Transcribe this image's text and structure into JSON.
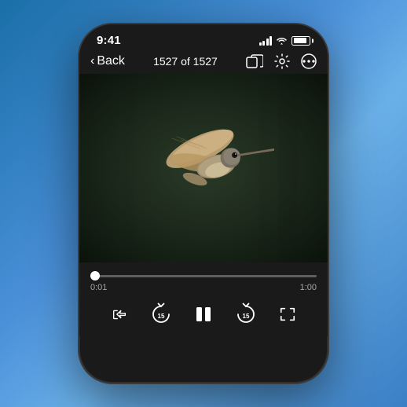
{
  "status_bar": {
    "time": "9:41"
  },
  "nav": {
    "back_label": "Back",
    "title": "1527 of 1527",
    "icons": {
      "duplicate": "⧉",
      "settings": "⚙",
      "more": "•••"
    }
  },
  "video": {
    "progress_current": "0:01",
    "progress_end": "1:00",
    "progress_percent": 2
  },
  "controls": {
    "share_label": "share",
    "skip_back_label": "15",
    "play_pause_label": "pause",
    "skip_forward_label": "15",
    "fullscreen_label": "fullscreen"
  }
}
